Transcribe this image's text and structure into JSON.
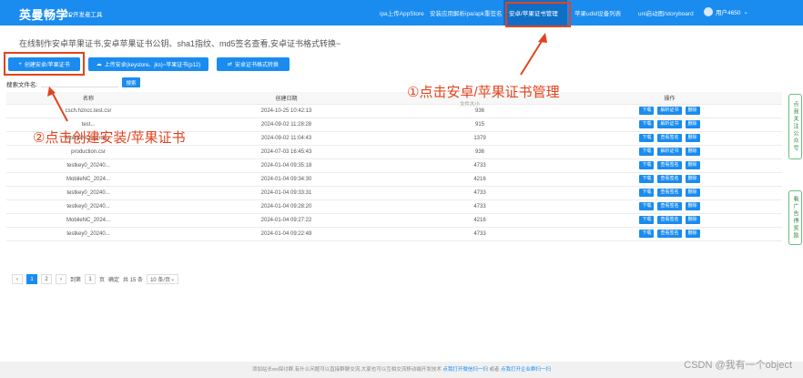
{
  "nav": {
    "brand": "英曼畅学-",
    "brand_sub": "APP开发者工具",
    "items": [
      "ipa上传AppStore",
      "安装应用解析ipa/apk重签名",
      "安卓/苹果证书管理",
      "苹果udid设备列表",
      "uni启动图/storyboard"
    ],
    "user": "用户4650"
  },
  "subtitle": "在线制作安卓苹果证书,安卓苹果证书公钥、sha1指纹、md5签名查看,安卓证书格式转换~",
  "toolbar": {
    "create": "创建安卓/苹果证书",
    "upload": "上传安卓(keystore、jks)~苹果证书(p12)",
    "convert": "安卓证书格式转换"
  },
  "search": {
    "label": "搜索文件名:",
    "button": "搜索"
  },
  "table": {
    "headers": [
      "名称",
      "创建日期",
      "文件大小",
      "操作"
    ],
    "rows": [
      {
        "name": "csch.hzncc.test.csr",
        "date": "2024-10-25 10:42:13",
        "size": "936",
        "ops": [
          "下载",
          "解析证书",
          "删除"
        ]
      },
      {
        "name": "test...",
        "date": "2024-09-02 11:28:28",
        "size": "915",
        "ops": [
          "下载",
          "解析证书",
          "删除"
        ]
      },
      {
        "name": "MobileNCStanda...",
        "date": "2024-09-02 11:04:43",
        "size": "1379",
        "ops": [
          "下载",
          "查看签名",
          "删除"
        ]
      },
      {
        "name": "production.csr",
        "date": "2024-07-03 16:45:43",
        "size": "936",
        "ops": [
          "下载",
          "解析证书",
          "删除"
        ]
      },
      {
        "name": "testkey0_20240...",
        "date": "2024-01-04 09:35:18",
        "size": "4733",
        "ops": [
          "下载",
          "查看签名",
          "删除"
        ]
      },
      {
        "name": "MobileNC_2024...",
        "date": "2024-01-04 09:34:30",
        "size": "4216",
        "ops": [
          "下载",
          "查看签名",
          "删除"
        ]
      },
      {
        "name": "testkey0_20240...",
        "date": "2024-01-04 09:33:31",
        "size": "4733",
        "ops": [
          "下载",
          "查看签名",
          "删除"
        ]
      },
      {
        "name": "testkey0_20240...",
        "date": "2024-01-04 09:28:20",
        "size": "4733",
        "ops": [
          "下载",
          "查看签名",
          "删除"
        ]
      },
      {
        "name": "MobileNC_2024...",
        "date": "2024-01-04 09:27:22",
        "size": "4216",
        "ops": [
          "下载",
          "查看签名",
          "删除"
        ]
      },
      {
        "name": "testkey0_20240...",
        "date": "2024-01-04 09:22:49",
        "size": "4733",
        "ops": [
          "下载",
          "查看签名",
          "删除"
        ]
      }
    ]
  },
  "pager": {
    "prev": "‹",
    "pages": [
      "1",
      "2"
    ],
    "next": "›",
    "goto_label": "到第",
    "goto_value": "1",
    "page_unit": "页",
    "confirm": "确定",
    "total": "共 15 条",
    "per_page": "10 条/页"
  },
  "side_tabs": [
    "点我关注公众号",
    "看广告得奖励"
  ],
  "footer": {
    "text": "添加站长wx探讨群,有什么问题可以直接群聊交流,大家也可以互相交流移动端开发技术",
    "link1": "点我打开微信扫一扫",
    "or": "或者",
    "link2": "点我打开企业群扫一扫"
  },
  "watermark": "CSDN @我有一个object",
  "annotations": {
    "step1": "①点击安卓/苹果证书管理",
    "step2": "②点击创建安装/苹果证书"
  },
  "colors": {
    "primary": "#1a8cf0",
    "annotation": "#e2431e"
  }
}
